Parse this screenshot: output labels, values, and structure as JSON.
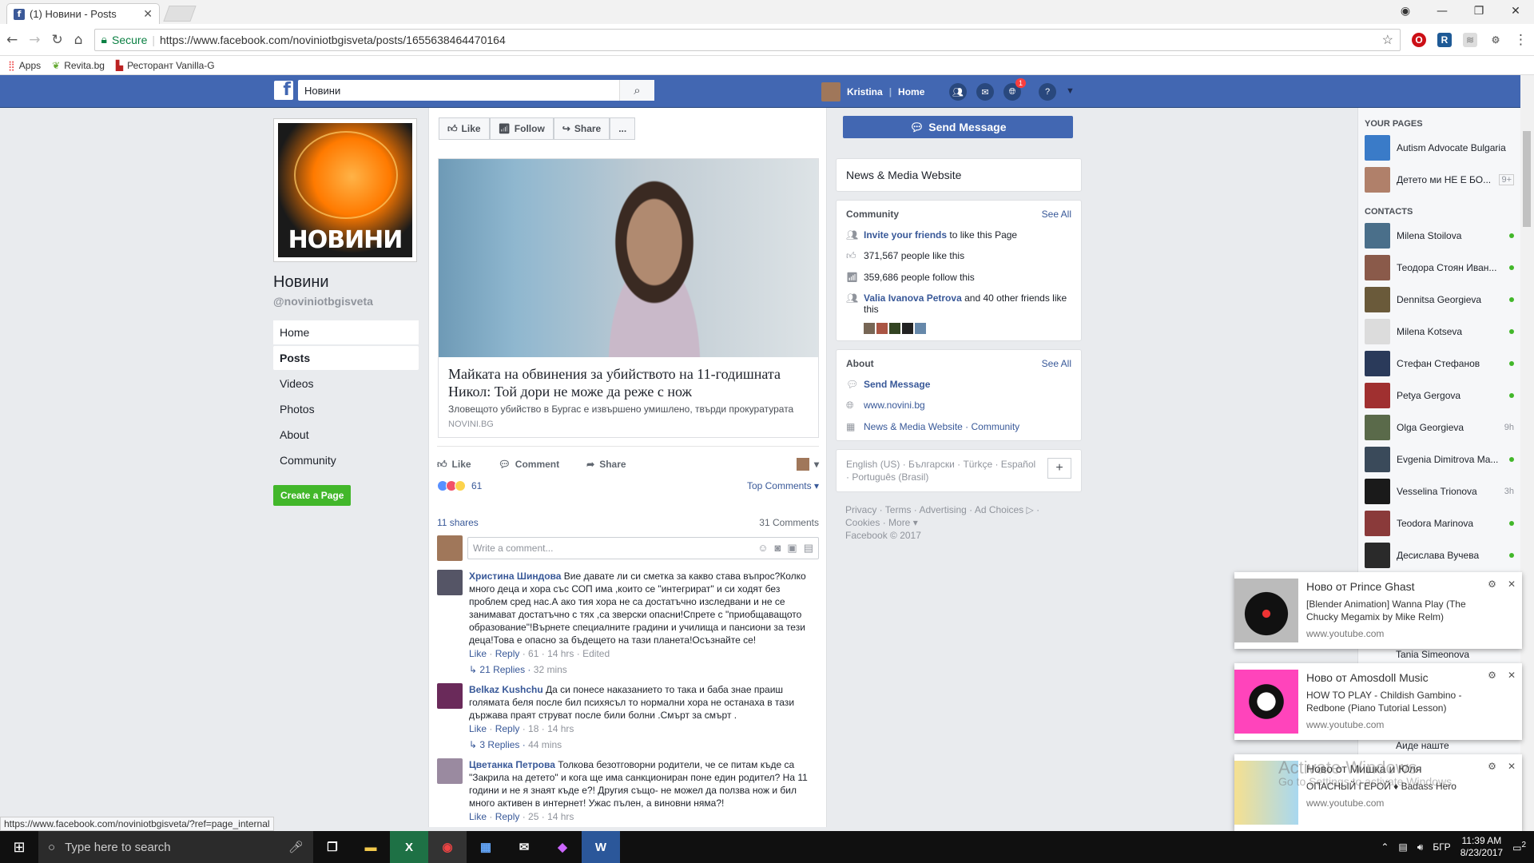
{
  "browser": {
    "tab_title": "(1) Новини - Posts",
    "secure_label": "Secure",
    "url": "https://www.facebook.com/noviniotbgisveta/posts/1655638464470164",
    "bookmarks": [
      "Apps",
      "Revita.bg",
      "Ресторант Vanilla-G"
    ],
    "status_url": "https://www.facebook.com/noviniotbgisveta/?ref=page_internal"
  },
  "fb": {
    "search_value": "Новини",
    "user_name": "Kristina",
    "home_label": "Home",
    "notif_count": "1"
  },
  "page": {
    "logo_text": "НОВИНИ",
    "name": "Новини",
    "handle": "@noviniotbgisveta",
    "nav": [
      "Home",
      "Posts",
      "Videos",
      "Photos",
      "About",
      "Community"
    ],
    "create_page": "Create a Page"
  },
  "post": {
    "buttons": [
      "Like",
      "Follow",
      "Share",
      "..."
    ],
    "link_title": "Майката на обвинения за убийството на 11-годишната Никол: Той дори не може да реже с нож",
    "link_sub": "Зловещото убийство в Бургас е извършено умишлено, твърди прокуратурата",
    "link_source": "NOVINI.BG",
    "actions": [
      "Like",
      "Comment",
      "Share"
    ],
    "reaction_count": "61",
    "top_comments": "Top Comments",
    "shares": "11 shares",
    "comment_count": "31 Comments",
    "write_placeholder": "Write a comment...",
    "comments": [
      {
        "name": "Христина Шиндова",
        "text": "Вие давате ли си сметка за какво става въпрос?Колко много деца и хора със СОП има ,които се \"интегрират\" и си ходят без проблем сред нас.А ако тия хора не са достатъчно изследвани и не се занимават достатъчно с тях ,са зверски опасни!Спрете с \"приобщаващото образование\"!Върнете специалните градини и училища и пансиони за тези деца!Това е опасно за бъдещето на тази планета!Осъзнайте се!",
        "like": "Like",
        "reply": "Reply",
        "reacts": "61",
        "time": "14 hrs",
        "edited": "Edited",
        "replies": "21 Replies",
        "replies_time": "32 mins"
      },
      {
        "name": "Belkaz Kushchu",
        "text": "Да си понесе наказанието то така и баба знае праиш голямата беля после бил психясъл то нормални хора не останаха в тази държава праят струват после били болни .Смърт за смърт .",
        "like": "Like",
        "reply": "Reply",
        "reacts": "18",
        "time": "14 hrs",
        "replies": "3 Replies",
        "replies_time": "44 mins"
      },
      {
        "name": "Цветанка Петрова",
        "text": "Толкова безотговорни родители, че се питам къде са \"Закрила на детето\" и кога ще има санкциониран поне един родител? На 11 години и не я знаят къде е?! Другия също- не можел да ползва нож и бил много активен в интернет! Ужас пълен, а виновни няма?!",
        "like": "Like",
        "reply": "Reply",
        "reacts": "25",
        "time": "14 hrs"
      }
    ]
  },
  "right": {
    "send_message": "Send Message",
    "category": "News & Media Website",
    "community_head": "Community",
    "see_all": "See All",
    "invite_link": "Invite your friends",
    "invite_rest": "to like this Page",
    "likes": "371,567 people like this",
    "follows": "359,686 people follow this",
    "friend_link": "Valia Ivanova Petrova",
    "friend_rest": "and 40 other friends like this",
    "about_head": "About",
    "about_msg": "Send Message",
    "website": "www.novini.bg",
    "about_cat": "News & Media Website · Community",
    "langs": "English (US) · Български · Türkçe · Español · Português (Brasil)",
    "footer1": "Privacy · Terms · Advertising · Ad Choices ▷ ·",
    "footer2": "Cookies · More ▾",
    "footer3": "Facebook © 2017"
  },
  "chat": {
    "your_pages": "YOUR PAGES",
    "pages": [
      {
        "name": "Autism Advocate Bulgaria",
        "color": "#3a7bc8"
      },
      {
        "name": "Детето ми НЕ Е БО...",
        "color": "#b0806a",
        "tag": "9+"
      }
    ],
    "contacts_head": "CONTACTS",
    "contacts": [
      {
        "name": "Milena Stoilova",
        "color": "#4a6f8a",
        "status": "online"
      },
      {
        "name": "Теодора Стоян Иван...",
        "color": "#8a5a4a",
        "status": "online"
      },
      {
        "name": "Dennitsa Georgieva",
        "color": "#6a5a3a",
        "status": "online"
      },
      {
        "name": "Milena Kotseva",
        "color": "#dcdcdc",
        "status": "online"
      },
      {
        "name": "Стефан Стефанов",
        "color": "#2a3a5a",
        "status": "online"
      },
      {
        "name": "Petya Gergova",
        "color": "#a03030",
        "status": "online"
      },
      {
        "name": "Olga Georgieva",
        "color": "#5a6a4a",
        "status": "9h"
      },
      {
        "name": "Evgenia Dimitrova Ma...",
        "color": "#3a4a5a",
        "status": "online"
      },
      {
        "name": "Vesselina Trionova",
        "color": "#1a1a1a",
        "status": "3h"
      },
      {
        "name": "Teodora Marinova",
        "color": "#8a3a3a",
        "status": "online"
      },
      {
        "name": "Десислава Вучева",
        "color": "#2a2a2a",
        "status": "online"
      }
    ]
  },
  "notifications": [
    {
      "title": "Ново от Prince Ghast",
      "desc": "[Blender Animation] Wanna Play (The Chucky Megamix by Mike Relm)",
      "site": "www.youtube.com",
      "below": "Tania Simeonova"
    },
    {
      "title": "Ново от Amosdoll Music",
      "desc": "HOW TO PLAY - Childish Gambino - Redbone (Piano Tutorial Lesson)",
      "site": "www.youtube.com",
      "below": "Аиде наште"
    },
    {
      "title": "Ново от Мишка и Юля",
      "desc": "ОПАСНЫЙ ГЕРОЙ ♦ Badass Hero",
      "site": "www.youtube.com"
    }
  ],
  "taskbar": {
    "search_placeholder": "Type here to search",
    "lang": "БГР",
    "time": "11:39 AM",
    "date": "8/23/2017",
    "notif": "2"
  },
  "watermark": {
    "line1": "Activate Windows",
    "line2": "Go to Settings to activate Windows."
  }
}
